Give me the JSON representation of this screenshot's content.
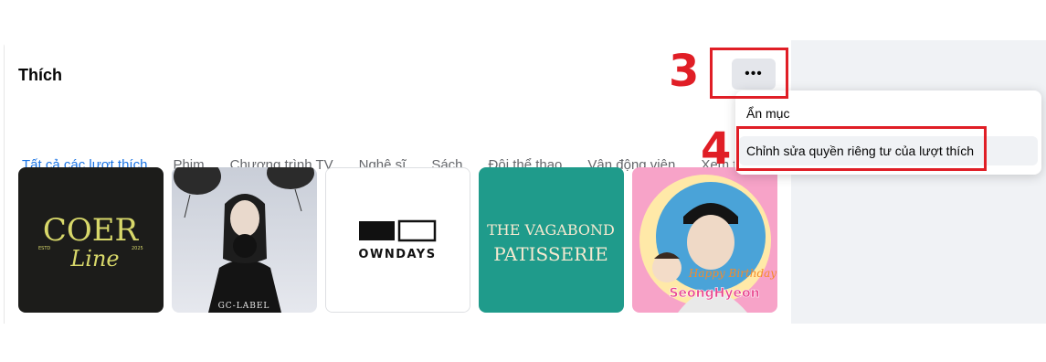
{
  "section": {
    "title": "Thích",
    "more_label": "•••"
  },
  "tabs": [
    {
      "label": "Tất cả các lượt thích",
      "active": true
    },
    {
      "label": "Phim"
    },
    {
      "label": "Chương trình TV"
    },
    {
      "label": "Nghệ sĩ"
    },
    {
      "label": "Sách"
    },
    {
      "label": "Đội thể thao"
    },
    {
      "label": "Vận động viên"
    },
    {
      "label": "Xem thêm"
    }
  ],
  "menu": {
    "hide_section": "Ẩn mục",
    "edit_privacy": "Chỉnh sửa quyền riêng tư của lượt thích"
  },
  "annotations": {
    "step3": "3",
    "step4": "4"
  },
  "tiles": [
    {
      "name": "COER Line",
      "line1": "COER",
      "line2": "Line",
      "left": "ESTD",
      "right": "2025"
    },
    {
      "name": "GC-LABEL",
      "caption": "GC-LABEL"
    },
    {
      "name": "OWNDAYS",
      "caption": "OWNDAYS"
    },
    {
      "name": "The Vagabond Patisserie",
      "line1": "THE VAGABOND",
      "line2": "PATISSERIE"
    },
    {
      "name": "SeongHyeon",
      "caption": "SeongHyeon",
      "sub": "Happy Birthday"
    }
  ],
  "colors": {
    "accent": "#1b74e4",
    "annotation_red": "#e01e26",
    "tile_dark": "#1a1a1a",
    "tile_teal": "#1e9a8a",
    "tile_pink": "#f58fc0"
  }
}
